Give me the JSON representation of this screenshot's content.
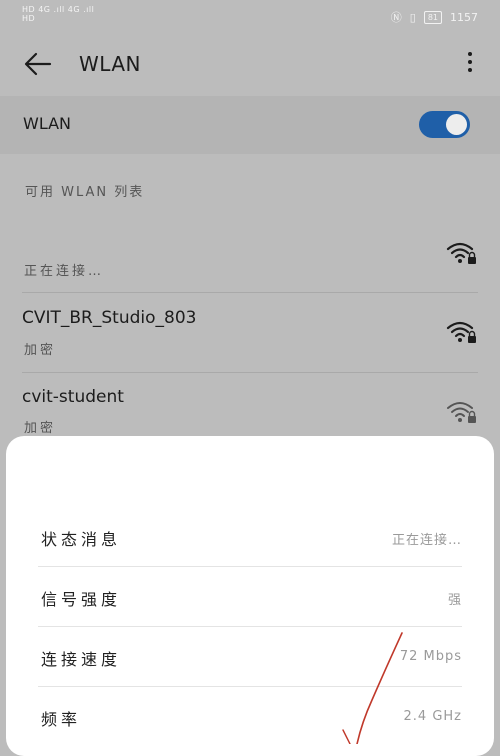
{
  "status_bar": {
    "left_line1": "HD 4G .ıll 4G .ıll",
    "left_line2": "HD",
    "icons": [
      "nfc-icon",
      "vibrate-icon"
    ],
    "battery": "81",
    "time": "1157"
  },
  "header": {
    "back_icon": "arrow-left-icon",
    "title": "WLAN",
    "more_icon": "more-vertical-icon"
  },
  "wlan_toggle": {
    "label": "WLAN",
    "on": true,
    "accent": "#1f5fa8"
  },
  "section": {
    "title": "可用 WLAN 列表"
  },
  "networks": [
    {
      "name": "",
      "status": "正在连接…",
      "icon": "wifi-secured-icon"
    },
    {
      "name": "CVIT_BR_Studio_803",
      "status": "加密",
      "icon": "wifi-secured-icon"
    },
    {
      "name": "cvit-student",
      "status": "加密",
      "icon": "wifi-secured-icon"
    }
  ],
  "details": [
    {
      "label": "状态消息",
      "value": "正在连接…"
    },
    {
      "label": "信号强度",
      "value": "强"
    },
    {
      "label": "连接速度",
      "value": "72 Mbps"
    },
    {
      "label": "频率",
      "value": "2.4 GHz"
    }
  ],
  "colors": {
    "dim_background": "#bcbcbc",
    "sheet_background": "#ffffff",
    "annotation_stroke": "#c0392b"
  }
}
